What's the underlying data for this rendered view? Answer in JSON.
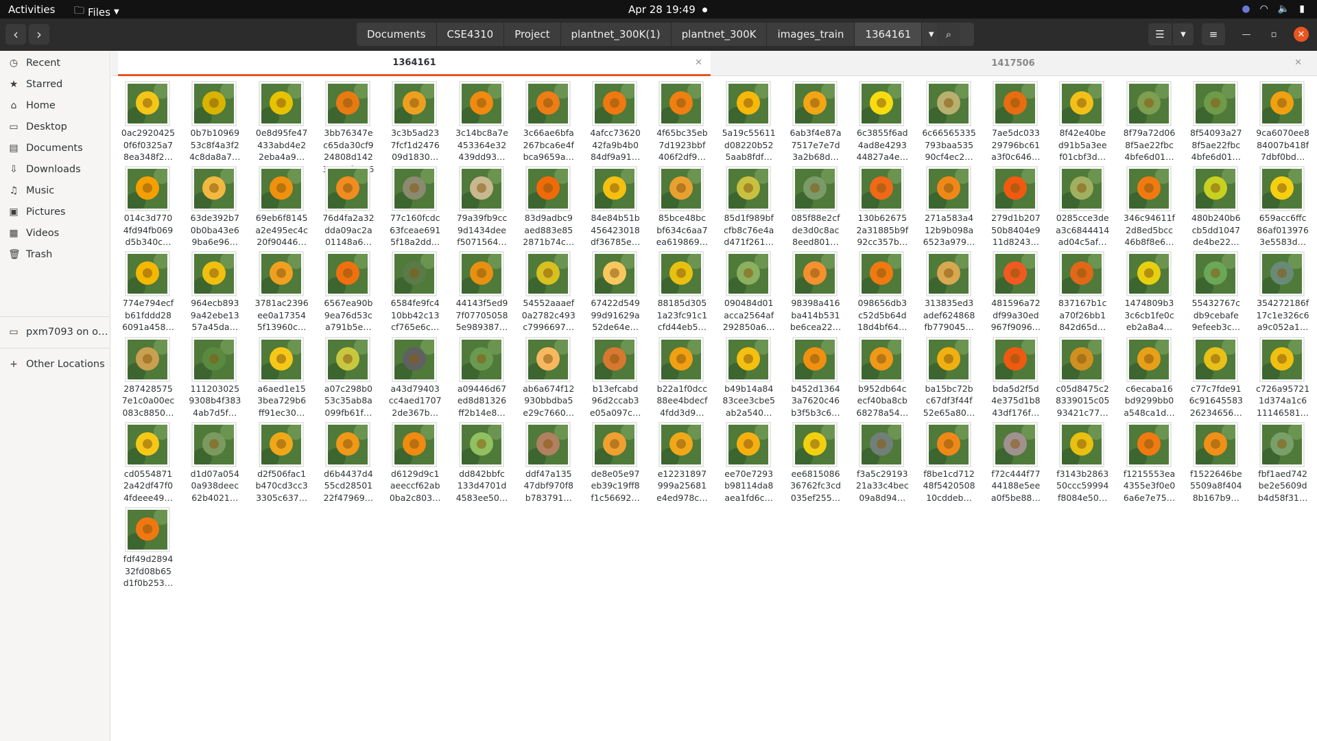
{
  "topbar": {
    "activities": "Activities",
    "app_menu": "Files",
    "clock": "Apr 28  19:49"
  },
  "path": [
    "Documents",
    "CSE4310",
    "Project",
    "plantnet_300K(1)",
    "plantnet_300K",
    "images_train",
    "1364161"
  ],
  "sidebar": {
    "items": [
      {
        "label": "Recent",
        "icon": "clock-icon",
        "glyph": "◷"
      },
      {
        "label": "Starred",
        "icon": "star-icon",
        "glyph": "★"
      },
      {
        "label": "Home",
        "icon": "home-icon",
        "glyph": "⌂"
      },
      {
        "label": "Desktop",
        "icon": "desktop-icon",
        "glyph": "▭"
      },
      {
        "label": "Documents",
        "icon": "document-icon",
        "glyph": "▤"
      },
      {
        "label": "Downloads",
        "icon": "download-icon",
        "glyph": "⇩"
      },
      {
        "label": "Music",
        "icon": "music-icon",
        "glyph": "♫"
      },
      {
        "label": "Pictures",
        "icon": "pictures-icon",
        "glyph": "▣"
      },
      {
        "label": "Videos",
        "icon": "video-icon",
        "glyph": "▦"
      },
      {
        "label": "Trash",
        "icon": "trash-icon",
        "glyph": "🗑"
      }
    ],
    "network_drive": "pxm7093 on o…",
    "other_locations": "Other Locations"
  },
  "tabs": [
    {
      "label": "1364161",
      "active": true
    },
    {
      "label": "1417506",
      "active": false
    }
  ],
  "files": [
    {
      "name": "0ac2920425\n0f6f0325a7\n8ea348f2…",
      "color": "#f5c518"
    },
    {
      "name": "0b7b10969\n53c8f4a3f2\n4c8da8a7…",
      "color": "#d8b400"
    },
    {
      "name": "0e8d95fe47\n433abd4e2\n2eba4a9…",
      "color": "#e6c200"
    },
    {
      "name": "3bb76347e\nc65da30cf9\n24808d142\n37e00fc236\n85.jpg",
      "color": "#e87a12"
    },
    {
      "name": "3c3b5ad23\n7fcf1d2476\n09d1830…",
      "color": "#eda020"
    },
    {
      "name": "3c14bc8a7e\n453364e32\n439dd93…",
      "color": "#f08a10"
    },
    {
      "name": "3c66ae6bfa\n267bca6e4f\nbca9659a…",
      "color": "#ee7d15"
    },
    {
      "name": "4afcc73620\n42fa9b4b0\n84df9a91…",
      "color": "#f07810"
    },
    {
      "name": "4f65bc35eb\n7d1923bbf\n406f2df9…",
      "color": "#f07f12"
    },
    {
      "name": "5a19c55611\nd08220b52\n5aab8fdf…",
      "color": "#f7b80a"
    },
    {
      "name": "6ab3f4e87a\n7517e7e7d\n3a2b68d…",
      "color": "#f2a515"
    },
    {
      "name": "6c3855f6ad\n4ad8e4293\n44827a4e…",
      "color": "#f8dc10"
    },
    {
      "name": "6c66565335\n793baa535\n90cf4ec2…",
      "color": "#b8b070"
    },
    {
      "name": "7ae5dc033\n29796bc61\na3f0c646…",
      "color": "#e86d10"
    },
    {
      "name": "8f42e40be\nd91b5a3ee\nf01cbf3d…",
      "color": "#f2c018"
    },
    {
      "name": "8f79a72d06\n8f5ae22fbc\n4bfe6d01…",
      "color": "#7e9e50"
    },
    {
      "name": "8f54093a27\n8f5ae22fbc\n4bfe6d01…",
      "color": "#6f9a48"
    },
    {
      "name": "9ca6070ee8\n84007b418f\n7dbf0bd…",
      "color": "#f0a010"
    },
    {
      "name": "014c3d770\n4fd94fb069\nd5b340c…",
      "color": "#f5a000"
    },
    {
      "name": "63de392b7\n0b0ba43e6\n9ba6e96…",
      "color": "#f2b840"
    },
    {
      "name": "69eb6f8145\na2e495ec4c\n20f90446…",
      "color": "#f0900f"
    },
    {
      "name": "76d4fa2a32\ndda09ac2a\n01148a6…",
      "color": "#f08c20"
    },
    {
      "name": "77c160fcdc\n63fceae691\n5f18a2dd…",
      "color": "#8a8a70"
    },
    {
      "name": "79a39fb9cc\n9d1434dee\nf5071564…",
      "color": "#c8b890"
    },
    {
      "name": "83d9adbc9\naed883e85\n2871b74c…",
      "color": "#f06a08"
    },
    {
      "name": "84e84b51b\n456423018\ndf36785e…",
      "color": "#f5c010"
    },
    {
      "name": "85bce48bc\nbf634c6aa7\nea619869…",
      "color": "#e8a030"
    },
    {
      "name": "85d1f989bf\ncfb8c76e4a\nd471f261…",
      "color": "#c8c040"
    },
    {
      "name": "085f88e2cf\nde3d0c8ac\n8eed801…",
      "color": "#7a9a68"
    },
    {
      "name": "130b62675\n2a31885b9f\n92cc357b…",
      "color": "#f06818"
    },
    {
      "name": "271a583a4\n12b9b098a\n6523a979…",
      "color": "#f08818"
    },
    {
      "name": "279d1b207\n50b8404e9\n11d8243…",
      "color": "#f05a10"
    },
    {
      "name": "0285cce3de\na3c6844414\nad04c5af…",
      "color": "#a0b060"
    },
    {
      "name": "346c94611f\n2d8ed5bcc\n46b8f8e6…",
      "color": "#f07a10"
    },
    {
      "name": "480b240b6\ncb5dd1047\nde4be22…",
      "color": "#c8d020"
    },
    {
      "name": "659acc6ffc\n86af013976\n3e5583d…",
      "color": "#f5d010"
    },
    {
      "name": "774e794ecf\nb61fddd28\n6091a458…",
      "color": "#f5b800"
    },
    {
      "name": "964ecb893\n9a42ebe13\n57a45da…",
      "color": "#f0c010"
    },
    {
      "name": "3781ac2396\nee0a17354\n5f13960c…",
      "color": "#f0a020"
    },
    {
      "name": "6567ea90b\n9ea76d53c\na791b5e…",
      "color": "#f07010"
    },
    {
      "name": "6584fe9fc4\n10bb42c13\ncf765e6c…",
      "color": "#5a7a48"
    },
    {
      "name": "44143f5ed9\n7f07705058\n5e989387…",
      "color": "#e89010"
    },
    {
      "name": "54552aaaef\n0a2782c493\nc7996697…",
      "color": "#d8c020"
    },
    {
      "name": "67422d549\n99d91629a\n52de64e…",
      "color": "#f8c860"
    },
    {
      "name": "88185d305\n1a23fc91c1\ncfd44eb5…",
      "color": "#e8c010"
    },
    {
      "name": "090484d01\nacca2564af\n292850a6…",
      "color": "#8ab060"
    },
    {
      "name": "98398a416\nba414b531\nbe6cea22…",
      "color": "#f59030"
    },
    {
      "name": "098656db3\nc52d5b64d\n18d4bf64…",
      "color": "#f07a10"
    },
    {
      "name": "313835ed3\nadef624868\nfb779045…",
      "color": "#d8a850"
    },
    {
      "name": "481596a72\ndf99a30ed\n967f9096…",
      "color": "#f05a20"
    },
    {
      "name": "837167b1c\na70f26bb1\n842d65d…",
      "color": "#e06818"
    },
    {
      "name": "1474809b3\n3c6cb1fe0c\neb2a8a4…",
      "color": "#e8d010"
    },
    {
      "name": "55432767c\ndb9cebafe\n9efeeb3c…",
      "color": "#6aa858"
    },
    {
      "name": "354272186f\n17c1e326c6\na9c052a1…",
      "color": "#6a8a78"
    },
    {
      "name": "287428575\n7e1c0a00ec\n083c8850…",
      "color": "#c8a050"
    },
    {
      "name": "111203025\n9308b4f383\n4ab7d5f…",
      "color": "#5a8a40"
    },
    {
      "name": "a6aed1e15\n3bea729b6\nff91ec30…",
      "color": "#f5c818"
    },
    {
      "name": "a07c298b0\n53c35ab8a\n099fb61f…",
      "color": "#c8c840"
    },
    {
      "name": "a43d79403\ncc4aed1707\n2de367b…",
      "color": "#606060"
    },
    {
      "name": "a09446d67\ned8d81326\nff2b14e8…",
      "color": "#6a9a50"
    },
    {
      "name": "ab6a674f12\n930bbdba5\ne29c7660…",
      "color": "#f8b860"
    },
    {
      "name": "b13efcabd\n96d2ccab3\ne05a097c…",
      "color": "#d87830"
    },
    {
      "name": "b22a1f0dcc\n88ee4bdecf\n4fdd3d9…",
      "color": "#f0a010"
    },
    {
      "name": "b49b14a84\n83cee3cbe5\nab2a540…",
      "color": "#f5c010"
    },
    {
      "name": "b452d1364\n3a7620c46\nb3f5b3c6…",
      "color": "#f09010"
    },
    {
      "name": "b952db64c\necf40ba8cb\n68278a54…",
      "color": "#f09818"
    },
    {
      "name": "ba15bc72b\nc67df3f44f\n52e65a80…",
      "color": "#f0b010"
    },
    {
      "name": "bda5d2f5d\n4e375d1b8\n43df176f…",
      "color": "#f05a10"
    },
    {
      "name": "c05d8475c2\n8339015c05\n93421c77…",
      "color": "#d09020"
    },
    {
      "name": "c6ecaba16\nbd9299bb0\na548ca1d…",
      "color": "#e8a018"
    },
    {
      "name": "c77c7fde91\n6c91645583\n26234656…",
      "color": "#e8c018"
    },
    {
      "name": "c726a95721\n1d374a1c6\n11146581…",
      "color": "#f0c010"
    },
    {
      "name": "cd0554871\n2a42df47f0\n4fdeee49…",
      "color": "#f5c818"
    },
    {
      "name": "d1d07a054\n0a938deec\n62b4021…",
      "color": "#7a9a60"
    },
    {
      "name": "d2f506fac1\nb470cd3cc3\n3305c637…",
      "color": "#f0a818"
    },
    {
      "name": "d6b4437d4\n55cd28501\n22f47969…",
      "color": "#f09818"
    },
    {
      "name": "d6129d9c1\naeeccf62ab\n0ba2c803…",
      "color": "#f08a10"
    },
    {
      "name": "dd842bbfc\n133d4701d\n4583ee50…",
      "color": "#90c060"
    },
    {
      "name": "ddf47a135\n47dbf970f8\nb783791…",
      "color": "#b08060"
    },
    {
      "name": "de8e05e97\neb39c19ff8\nf1c56692…",
      "color": "#f0a030"
    },
    {
      "name": "e12231897\n999a25681\ne4ed978c…",
      "color": "#f0a818"
    },
    {
      "name": "ee70e7293\nb98114da8\naea1fd6c…",
      "color": "#f5b010"
    },
    {
      "name": "ee6815086\n36762fc3cd\n035ef255…",
      "color": "#f0d010"
    },
    {
      "name": "f3a5c29193\n21a33c4bec\n09a8d94…",
      "color": "#708078"
    },
    {
      "name": "f8be1cd712\n48f5420508\n10cddeb…",
      "color": "#f08818"
    },
    {
      "name": "f72c444f77\n44188e5ee\na0f5be88…",
      "color": "#a09090"
    },
    {
      "name": "f3143b2863\n50ccc59994\nf8084e50…",
      "color": "#e8c010"
    },
    {
      "name": "f1215553ea\n4355e3f0e0\n6a6e7e75…",
      "color": "#f07a10"
    },
    {
      "name": "f1522646be\n5509a8f404\n8b167b9…",
      "color": "#f09018"
    },
    {
      "name": "fbf1aed742\nbe2e5609d\nb4d58f31…",
      "color": "#78a068"
    },
    {
      "name": "fdf49d2894\n32fd08b65\nd1f0b253…",
      "color": "#f07810"
    }
  ]
}
